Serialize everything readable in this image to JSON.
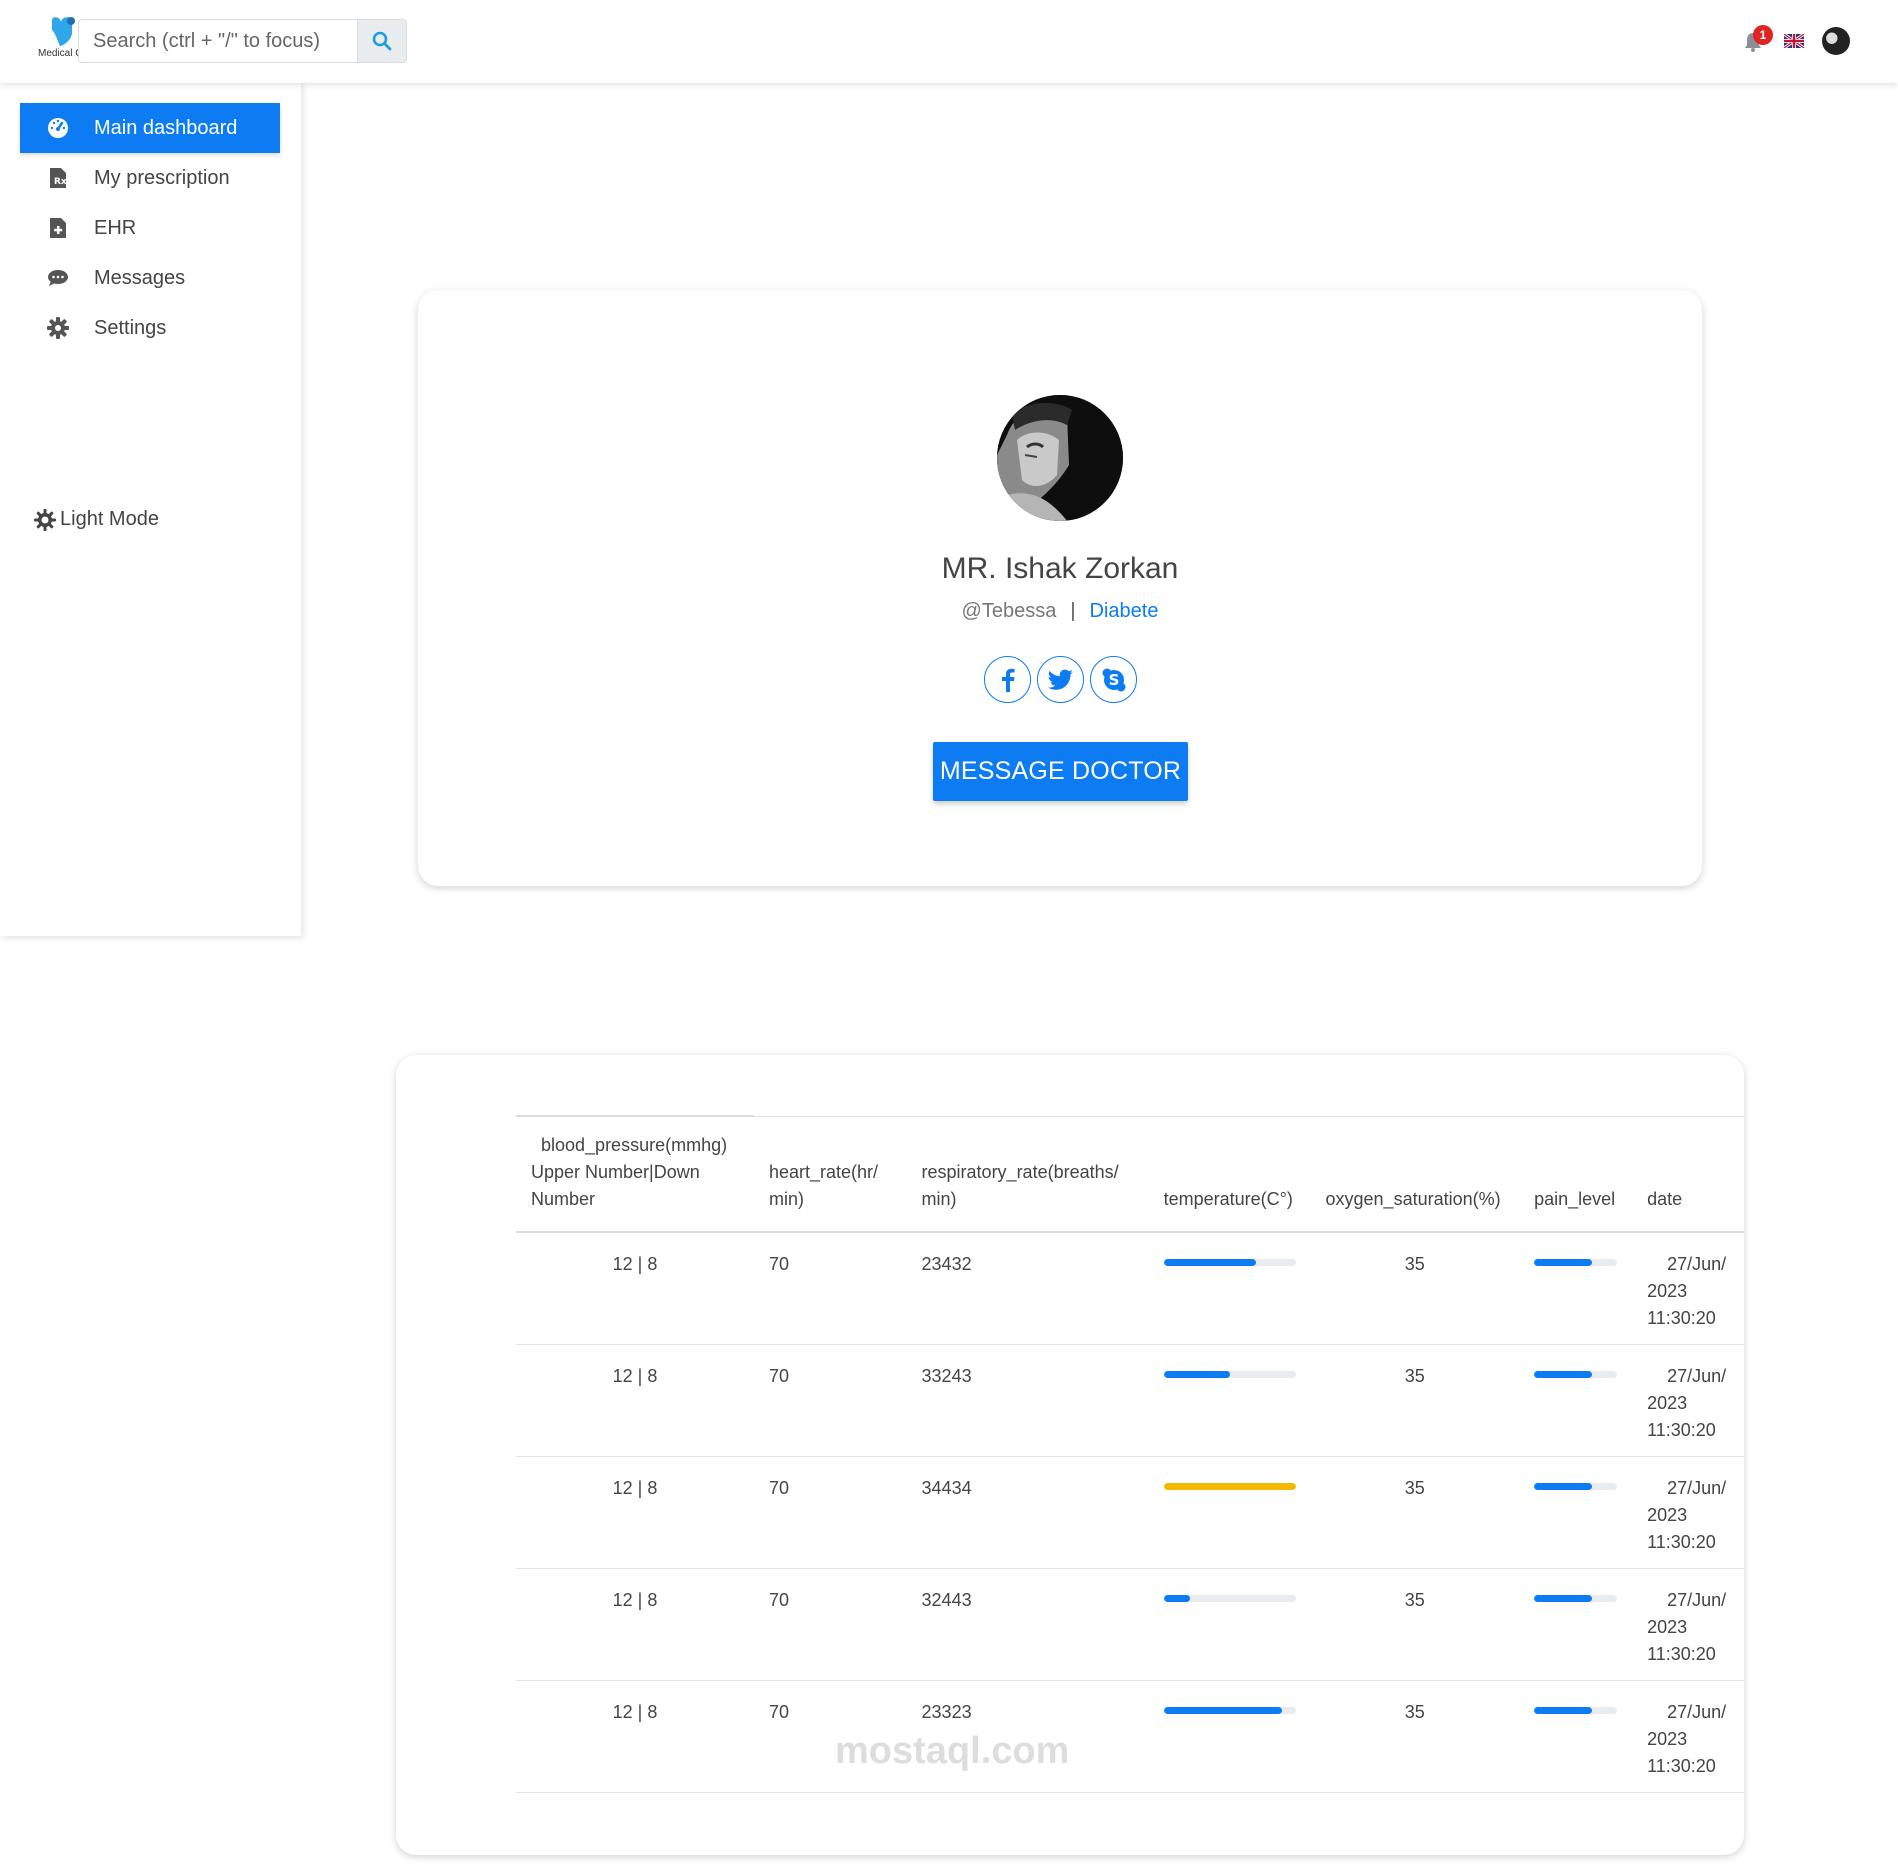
{
  "header": {
    "logo_text": "Medical C",
    "search_placeholder": "Search (ctrl + \"/\" to focus)",
    "notification_count": "1",
    "accent_color": "#0d7cf2"
  },
  "sidebar": {
    "items": [
      {
        "label": "Main dashboard",
        "icon": "dashboard-icon",
        "active": true
      },
      {
        "label": "My prescription",
        "icon": "prescription-icon",
        "active": false
      },
      {
        "label": "EHR",
        "icon": "medical-file-icon",
        "active": false
      },
      {
        "label": "Messages",
        "icon": "comments-icon",
        "active": false
      },
      {
        "label": "Settings",
        "icon": "gear-icon",
        "active": false
      }
    ],
    "theme_toggle": "Light Mode"
  },
  "profile": {
    "name": "MR. Ishak Zorkan",
    "location": "@Tebessa",
    "condition": "Diabete",
    "socials": [
      "facebook-icon",
      "twitter-icon",
      "skype-icon"
    ],
    "message_button": "MESSAGE DOCTOR"
  },
  "vitals": {
    "headers": {
      "blood_pressure_1": "blood_pressure(mmhg)",
      "blood_pressure_2": "Upper Number|Down",
      "blood_pressure_3": "Number",
      "heart_rate_1": "heart_rate(hr/",
      "heart_rate_2": "min)",
      "respiratory_rate_1": "respiratory_rate(breaths/",
      "respiratory_rate_2": "min)",
      "temperature": "temperature(C°)",
      "oxygen_saturation": "oxygen_saturation(%)",
      "pain_level": "pain_level",
      "date": "date"
    },
    "rows": [
      {
        "blood_pressure": "12 | 8",
        "heart_rate": "70",
        "respiratory_rate": "23432",
        "temperature_level": 0.7,
        "temperature_color": "#0d7cf2",
        "oxygen_saturation": "35",
        "pain_level": 0.7,
        "date_1": "27/Jun/",
        "date_2": "2023",
        "date_3": "11:30:20"
      },
      {
        "blood_pressure": "12 | 8",
        "heart_rate": "70",
        "respiratory_rate": "33243",
        "temperature_level": 0.5,
        "temperature_color": "#0d7cf2",
        "oxygen_saturation": "35",
        "pain_level": 0.7,
        "date_1": "27/Jun/",
        "date_2": "2023",
        "date_3": "11:30:20"
      },
      {
        "blood_pressure": "12 | 8",
        "heart_rate": "70",
        "respiratory_rate": "34434",
        "temperature_level": 1.0,
        "temperature_color": "#f5b800",
        "oxygen_saturation": "35",
        "pain_level": 0.7,
        "date_1": "27/Jun/",
        "date_2": "2023",
        "date_3": "11:30:20"
      },
      {
        "blood_pressure": "12 | 8",
        "heart_rate": "70",
        "respiratory_rate": "32443",
        "temperature_level": 0.2,
        "temperature_color": "#0d7cf2",
        "oxygen_saturation": "35",
        "pain_level": 0.7,
        "date_1": "27/Jun/",
        "date_2": "2023",
        "date_3": "11:30:20"
      },
      {
        "blood_pressure": "12 | 8",
        "heart_rate": "70",
        "respiratory_rate": "23323",
        "temperature_level": 0.9,
        "temperature_color": "#0d7cf2",
        "oxygen_saturation": "35",
        "pain_level": 0.7,
        "date_1": "27/Jun/",
        "date_2": "2023",
        "date_3": "11:30:20"
      }
    ]
  },
  "watermark": "mostaql.com"
}
